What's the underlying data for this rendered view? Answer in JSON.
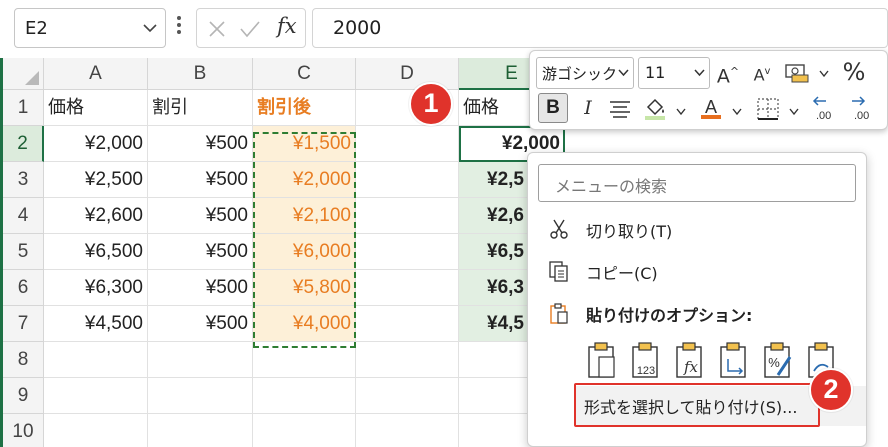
{
  "formula_bar": {
    "name_box": "E2",
    "formula": "2000",
    "fx_label": "fx"
  },
  "columns": [
    "A",
    "B",
    "C",
    "D",
    "E"
  ],
  "rows": [
    "1",
    "2",
    "3",
    "4",
    "5",
    "6",
    "7",
    "8",
    "9",
    "10"
  ],
  "headers": {
    "a": "価格",
    "b": "割引",
    "c": "割引後",
    "e": "価格"
  },
  "data_rows": [
    {
      "a": "¥2,000",
      "b": "¥500",
      "c": "¥1,500",
      "e": "¥2,000"
    },
    {
      "a": "¥2,500",
      "b": "¥500",
      "c": "¥2,000",
      "e": "¥2,5"
    },
    {
      "a": "¥2,600",
      "b": "¥500",
      "c": "¥2,100",
      "e": "¥2,6"
    },
    {
      "a": "¥6,500",
      "b": "¥500",
      "c": "¥6,000",
      "e": "¥6,5"
    },
    {
      "a": "¥6,300",
      "b": "¥500",
      "c": "¥5,800",
      "e": "¥6,3"
    },
    {
      "a": "¥4,500",
      "b": "¥500",
      "c": "¥4,000",
      "e": "¥4,5"
    }
  ],
  "mini_toolbar": {
    "font_name": "游ゴシック",
    "font_size": "11",
    "percent": "%",
    "bold": "B",
    "italic": "I",
    "grow": "A",
    "shrink": "A"
  },
  "context_menu": {
    "search_placeholder": "メニューの検索",
    "cut": "切り取り(T)",
    "copy": "コピー(C)",
    "paste_options": "貼り付けのオプション:",
    "paste_special": "形式を選択して貼り付け(S)..."
  },
  "callouts": {
    "one": "1",
    "two": "2"
  },
  "colors": {
    "accent_green": "#1e7145",
    "orange_text": "#e87d22",
    "callout_red": "#e0332b",
    "selection_fill": "#e2efe2"
  }
}
